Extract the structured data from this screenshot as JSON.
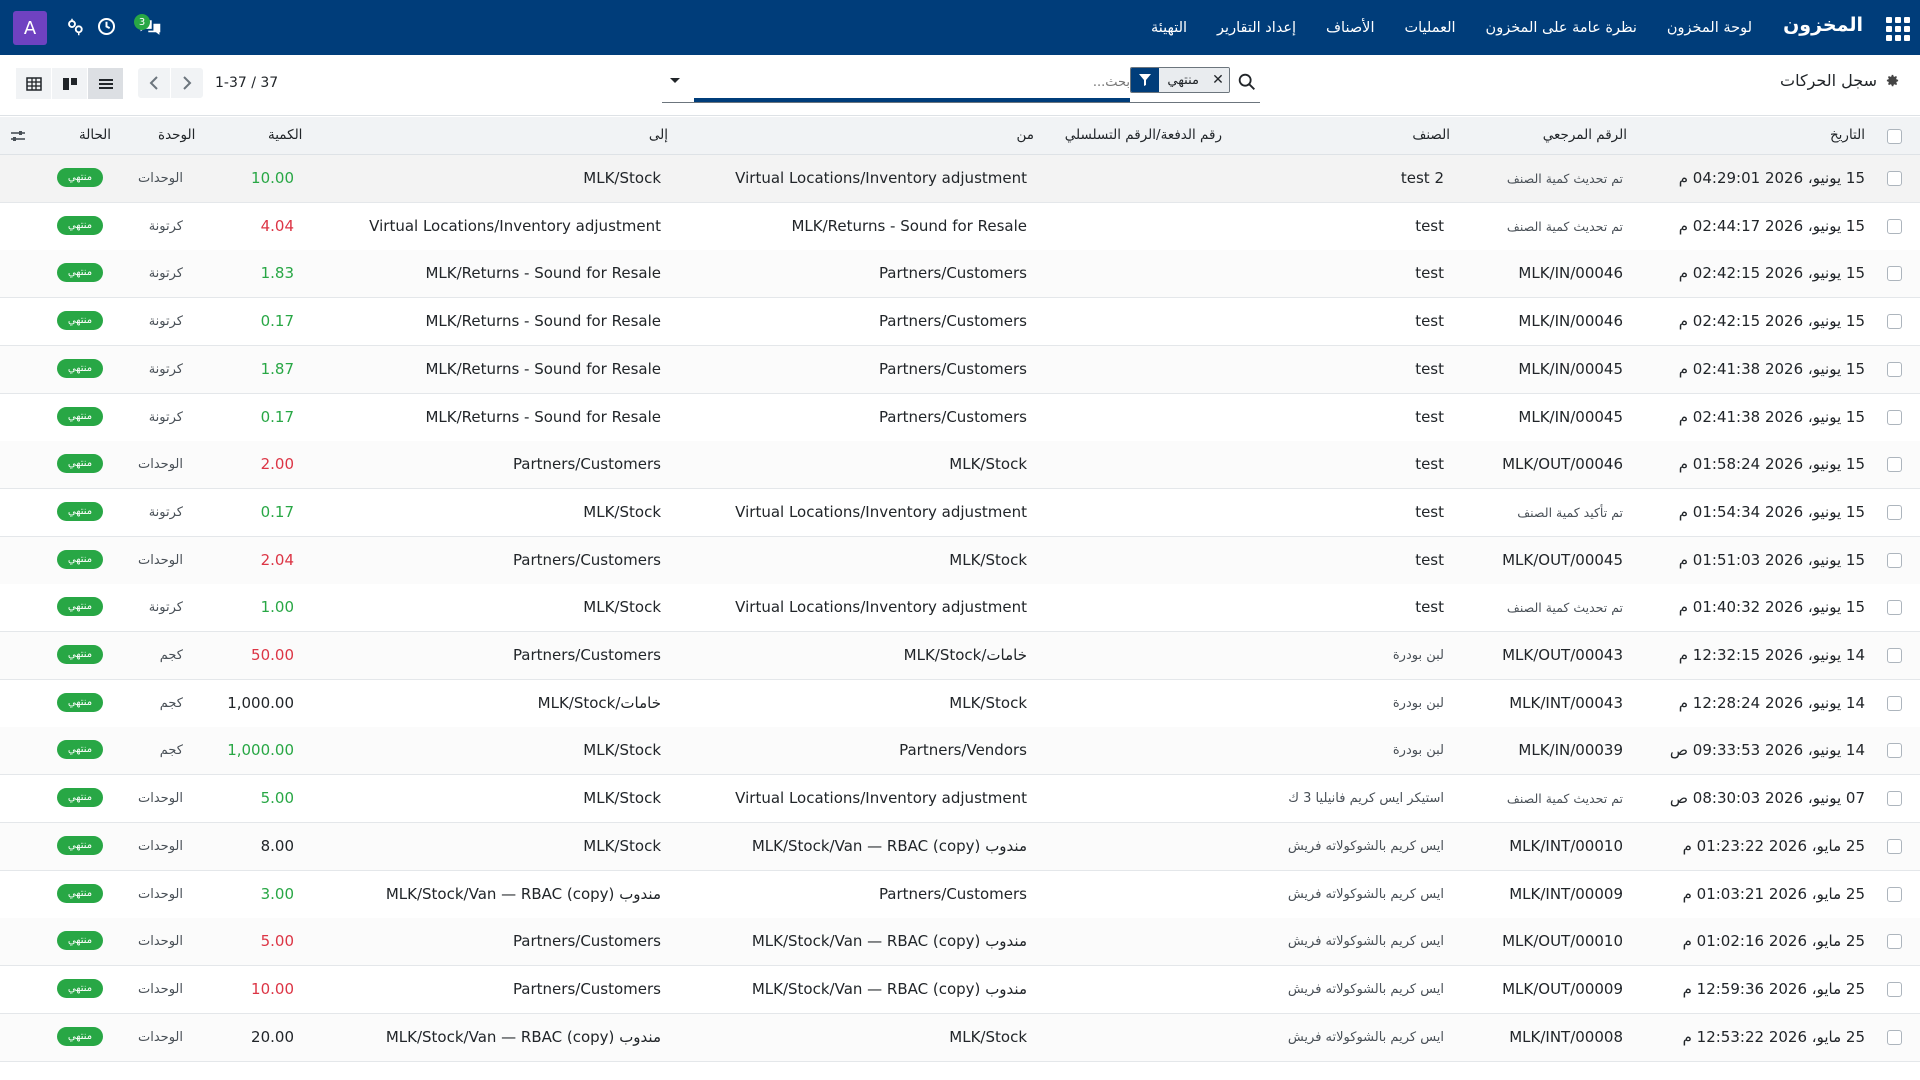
{
  "navbar": {
    "brand": "المخزون",
    "menu": [
      "لوحة المخزون",
      "نظرة عامة على المخزون",
      "العمليات",
      "الأصناف",
      "إعداد التقارير",
      "التهيئة"
    ],
    "avatar_letter": "A",
    "chat_count": "3",
    "accent": "#003d7a"
  },
  "control": {
    "breadcrumb": "سجل الحركات",
    "facet_value": "منتهي",
    "search_placeholder": "بحث...",
    "pager": "1-37 / 37"
  },
  "columns": {
    "date": "التاريخ",
    "reference": "الرقم المرجعي",
    "product": "الصنف",
    "lot": "رقم الدفعة/الرقم التسلسلي",
    "from": "من",
    "to": "إلى",
    "qty": "الكمية",
    "uom": "الوحدة",
    "status": "الحالة"
  },
  "rows": [
    {
      "date": "15 يونيو، 2026 04:29:01 م",
      "ref": "تم تحديث كمية الصنف",
      "product": "test 2",
      "from": "Virtual Locations/Inventory adjustment",
      "to": "MLK/Stock",
      "qty": "10.00",
      "qty_color": "green",
      "uom": "الوحدات",
      "status": "منتهي"
    },
    {
      "date": "15 يونيو، 2026 02:44:17 م",
      "ref": "تم تحديث كمية الصنف",
      "product": "test",
      "from": "MLK/Returns - Sound for Resale",
      "to": "Virtual Locations/Inventory adjustment",
      "qty": "4.04",
      "qty_color": "red",
      "uom": "كرتونة",
      "status": "منتهي"
    },
    {
      "date": "15 يونيو، 2026 02:42:15 م",
      "ref": "MLK/IN/00046",
      "product": "test",
      "from": "Partners/Customers",
      "to": "MLK/Returns - Sound for Resale",
      "qty": "1.83",
      "qty_color": "green",
      "uom": "كرتونة",
      "status": "منتهي"
    },
    {
      "date": "15 يونيو، 2026 02:42:15 م",
      "ref": "MLK/IN/00046",
      "product": "test",
      "from": "Partners/Customers",
      "to": "MLK/Returns - Sound for Resale",
      "qty": "0.17",
      "qty_color": "green",
      "uom": "كرتونة",
      "status": "منتهي"
    },
    {
      "date": "15 يونيو، 2026 02:41:38 م",
      "ref": "MLK/IN/00045",
      "product": "test",
      "from": "Partners/Customers",
      "to": "MLK/Returns - Sound for Resale",
      "qty": "1.87",
      "qty_color": "green",
      "uom": "كرتونة",
      "status": "منتهي"
    },
    {
      "date": "15 يونيو، 2026 02:41:38 م",
      "ref": "MLK/IN/00045",
      "product": "test",
      "from": "Partners/Customers",
      "to": "MLK/Returns - Sound for Resale",
      "qty": "0.17",
      "qty_color": "green",
      "uom": "كرتونة",
      "status": "منتهي"
    },
    {
      "date": "15 يونيو، 2026 01:58:24 م",
      "ref": "MLK/OUT/00046",
      "product": "test",
      "from": "MLK/Stock",
      "to": "Partners/Customers",
      "qty": "2.00",
      "qty_color": "red",
      "uom": "الوحدات",
      "status": "منتهي"
    },
    {
      "date": "15 يونيو، 2026 01:54:34 م",
      "ref": "تم تأكيد كمية الصنف",
      "product": "test",
      "from": "Virtual Locations/Inventory adjustment",
      "to": "MLK/Stock",
      "qty": "0.17",
      "qty_color": "green",
      "uom": "كرتونة",
      "status": "منتهي"
    },
    {
      "date": "15 يونيو، 2026 01:51:03 م",
      "ref": "MLK/OUT/00045",
      "product": "test",
      "from": "MLK/Stock",
      "to": "Partners/Customers",
      "qty": "2.04",
      "qty_color": "red",
      "uom": "الوحدات",
      "status": "منتهي"
    },
    {
      "date": "15 يونيو، 2026 01:40:32 م",
      "ref": "تم تحديث كمية الصنف",
      "product": "test",
      "from": "Virtual Locations/Inventory adjustment",
      "to": "MLK/Stock",
      "qty": "1.00",
      "qty_color": "green",
      "uom": "كرتونة",
      "status": "منتهي"
    },
    {
      "date": "14 يونيو، 2026 12:32:15 م",
      "ref": "MLK/OUT/00043",
      "product": "لبن بودرة",
      "from": "MLK/Stock/خامات",
      "to": "Partners/Customers",
      "qty": "50.00",
      "qty_color": "red",
      "uom": "كجم",
      "status": "منتهي"
    },
    {
      "date": "14 يونيو، 2026 12:28:24 م",
      "ref": "MLK/INT/00043",
      "product": "لبن بودرة",
      "from": "MLK/Stock",
      "to": "MLK/Stock/خامات",
      "qty": "1,000.00",
      "qty_color": "black",
      "uom": "كجم",
      "status": "منتهي"
    },
    {
      "date": "14 يونيو، 2026 09:33:53 ص",
      "ref": "MLK/IN/00039",
      "product": "لبن بودرة",
      "from": "Partners/Vendors",
      "to": "MLK/Stock",
      "qty": "1,000.00",
      "qty_color": "green",
      "uom": "كجم",
      "status": "منتهي"
    },
    {
      "date": "07 يونيو، 2026 08:30:03 ص",
      "ref": "تم تحديث كمية الصنف",
      "product": "استيكر ايس كريم فانيليا 3 ك",
      "from": "Virtual Locations/Inventory adjustment",
      "to": "MLK/Stock",
      "qty": "5.00",
      "qty_color": "green",
      "uom": "الوحدات",
      "status": "منتهي"
    },
    {
      "date": "25 مايو، 2026 01:23:22 م",
      "ref": "MLK/INT/00010",
      "product": "ايس كريم بالشوكولاته فريش",
      "from": "MLK/Stock/Van — RBAC (copy) مندوب",
      "to": "MLK/Stock",
      "qty": "8.00",
      "qty_color": "black",
      "uom": "الوحدات",
      "status": "منتهي"
    },
    {
      "date": "25 مايو، 2026 01:03:21 م",
      "ref": "MLK/INT/00009",
      "product": "ايس كريم بالشوكولاته فريش",
      "from": "Partners/Customers",
      "to": "MLK/Stock/Van — RBAC (copy) مندوب",
      "qty": "3.00",
      "qty_color": "green",
      "uom": "الوحدات",
      "status": "منتهي"
    },
    {
      "date": "25 مايو، 2026 01:02:16 م",
      "ref": "MLK/OUT/00010",
      "product": "ايس كريم بالشوكولاته فريش",
      "from": "MLK/Stock/Van — RBAC (copy) مندوب",
      "to": "Partners/Customers",
      "qty": "5.00",
      "qty_color": "red",
      "uom": "الوحدات",
      "status": "منتهي"
    },
    {
      "date": "25 مايو، 2026 12:59:36 م",
      "ref": "MLK/OUT/00009",
      "product": "ايس كريم بالشوكولاته فريش",
      "from": "MLK/Stock/Van — RBAC (copy) مندوب",
      "to": "Partners/Customers",
      "qty": "10.00",
      "qty_color": "red",
      "uom": "الوحدات",
      "status": "منتهي"
    },
    {
      "date": "25 مايو، 2026 12:53:22 م",
      "ref": "MLK/INT/00008",
      "product": "ايس كريم بالشوكولاته فريش",
      "from": "MLK/Stock",
      "to": "MLK/Stock/Van — RBAC (copy) مندوب",
      "qty": "20.00",
      "qty_color": "black",
      "uom": "الوحدات",
      "status": "منتهي"
    }
  ],
  "colors": {
    "green": "#28a745",
    "red": "#dc3545",
    "black": "#212529"
  }
}
